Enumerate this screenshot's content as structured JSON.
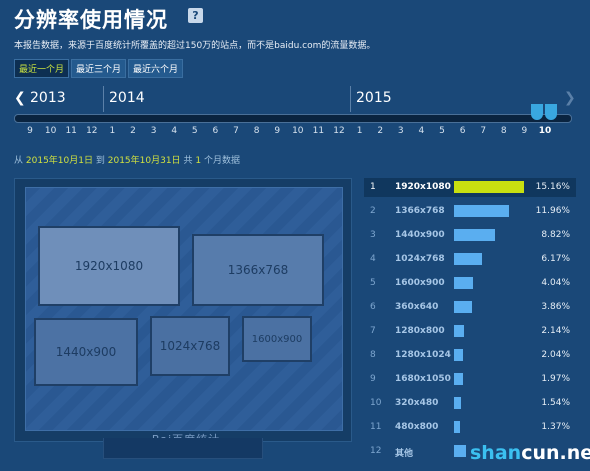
{
  "header": {
    "title": "分辨率使用情况",
    "help_glyph": "?",
    "description": "本报告数据，来源于百度统计所覆盖的超过150万的站点，而不是baidu.com的流量数据。"
  },
  "period_tabs": [
    "最近一个月",
    "最近三个月",
    "最近六个月"
  ],
  "timeline": {
    "prev_glyph": "❮",
    "next_glyph": "❯",
    "years": [
      "2013",
      "2014",
      "2015"
    ],
    "months": [
      "9",
      "10",
      "11",
      "12",
      "1",
      "2",
      "3",
      "4",
      "5",
      "6",
      "7",
      "8",
      "9",
      "10",
      "11",
      "12",
      "1",
      "2",
      "3",
      "4",
      "5",
      "6",
      "7",
      "8",
      "9",
      "10"
    ],
    "selected_month_index": 25
  },
  "date_range": {
    "from_label": "从",
    "start": "2015年10月1日",
    "to_label": "到",
    "end": "2015年10月31日",
    "total_label": "共",
    "count": "1",
    "suffix": "个月数据"
  },
  "monitor": {
    "brand": "Bai百度统计",
    "boxes": [
      "1920x1080",
      "1366x768",
      "1440x900",
      "1024x768",
      "1600x900"
    ]
  },
  "ranking": [
    {
      "rank": "1",
      "resolution": "1920x1080",
      "percent": "15.16%",
      "value": 15.16
    },
    {
      "rank": "2",
      "resolution": "1366x768",
      "percent": "11.96%",
      "value": 11.96
    },
    {
      "rank": "3",
      "resolution": "1440x900",
      "percent": "8.82%",
      "value": 8.82
    },
    {
      "rank": "4",
      "resolution": "1024x768",
      "percent": "6.17%",
      "value": 6.17
    },
    {
      "rank": "5",
      "resolution": "1600x900",
      "percent": "4.04%",
      "value": 4.04
    },
    {
      "rank": "6",
      "resolution": "360x640",
      "percent": "3.86%",
      "value": 3.86
    },
    {
      "rank": "7",
      "resolution": "1280x800",
      "percent": "2.14%",
      "value": 2.14
    },
    {
      "rank": "8",
      "resolution": "1280x1024",
      "percent": "2.04%",
      "value": 2.04
    },
    {
      "rank": "9",
      "resolution": "1680x1050",
      "percent": "1.97%",
      "value": 1.97
    },
    {
      "rank": "10",
      "resolution": "320x480",
      "percent": "1.54%",
      "value": 1.54
    },
    {
      "rank": "11",
      "resolution": "480x800",
      "percent": "1.37%",
      "value": 1.37
    },
    {
      "rank": "12",
      "resolution": "其他",
      "percent": "",
      "value": 2.5
    }
  ],
  "watermark": {
    "prefix": "shan",
    "suffix": "cun.net"
  }
}
